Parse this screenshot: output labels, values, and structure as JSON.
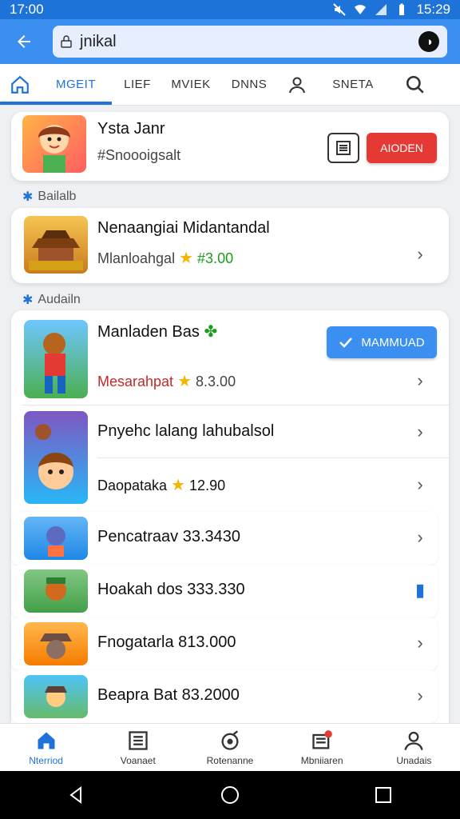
{
  "status": {
    "time": "17:00",
    "right_time": "15:29"
  },
  "appbar": {
    "url": "jnikal"
  },
  "tabs": [
    {
      "label": "MGEIT",
      "active": true
    },
    {
      "label": "LIEF"
    },
    {
      "label": "MVIEK"
    },
    {
      "label": "DNNS"
    },
    {
      "label": "SNETA"
    }
  ],
  "featured": {
    "title": "Ysta Janr",
    "subtitle": "#Snoooigsalt",
    "button": "AIODEN"
  },
  "sections": {
    "first": "Bailalb",
    "second": "Audailn"
  },
  "promo": {
    "title": "Nenaangiai Midantandal",
    "subtitle": "Mlanloahgal",
    "price": "#3.00"
  },
  "list_header": {
    "title": "Manladen Bas",
    "subtitle": "Mesarahpat",
    "rating": "8.3.00",
    "button": "MAMMUAD"
  },
  "items": [
    {
      "title": "Pnyehc lalang lahubalsol",
      "subtitle": ""
    },
    {
      "title": "Daopataka",
      "rating": "12.90"
    },
    {
      "title": "Pencatraav 33.3430"
    },
    {
      "title": "Hoakah dos 333.330"
    },
    {
      "title": "Fnogatarla 813.000"
    },
    {
      "title": "Beapra Bat 83.2000"
    }
  ],
  "bottom_nav": [
    {
      "label": "Nterriod",
      "active": true
    },
    {
      "label": "Voanaet"
    },
    {
      "label": "Rotenanne"
    },
    {
      "label": "Mbniiaren"
    },
    {
      "label": "Unadais"
    }
  ]
}
